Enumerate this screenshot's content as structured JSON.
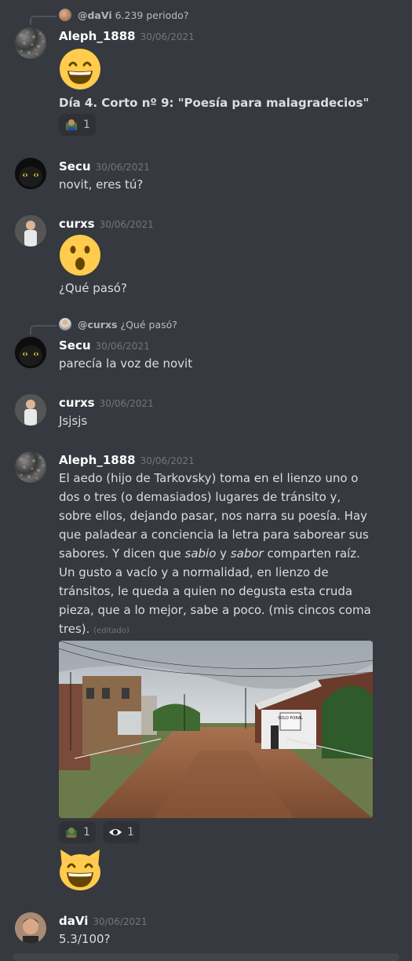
{
  "messages": [
    {
      "reply_user": "@daVi",
      "reply_text": "6.239 periodo?",
      "user": "Aleph_1888",
      "time": "30/06/2021",
      "emoji": "grinning-face",
      "bold_text": "Día 4. Corto nº 9: \"Poesía para malagradecios\"",
      "reactions": [
        {
          "icon": "custom-emoji-1",
          "count": "1"
        }
      ]
    },
    {
      "user": "Secu",
      "time": "30/06/2021",
      "text": "novit, eres tú?"
    },
    {
      "user": "curxs",
      "time": "30/06/2021",
      "emoji": "hushed-face",
      "text": "¿Qué pasó?"
    },
    {
      "reply_user": "@curxs",
      "reply_text": "¿Qué pasó?",
      "user": "Secu",
      "time": "30/06/2021",
      "text": "parecía la voz de novit"
    },
    {
      "user": "curxs",
      "time": "30/06/2021",
      "text": "Jsjsjs"
    },
    {
      "user": "Aleph_1888",
      "time": "30/06/2021",
      "lines": [
        "El aedo (hijo de Tarkovsky) toma en el lienzo uno o",
        "dos o tres (o demasiados) lugares de tránsito y,",
        "sobre ellos, dejando pasar, nos narra su poesía. Hay",
        "que paladear a conciencia la letra para saborear sus"
      ],
      "line5_a": "sabores. Y dicen que ",
      "line5_i1": "sabio",
      "line5_b": " y ",
      "line5_i2": "sabor",
      "line5_c": " comparten raíz.",
      "lines_after": [
        "Un gusto a vacío y a normalidad, en lienzo de",
        "tránsitos, le queda a quien no degusta esta cruda",
        "pieza, que a lo mejor, sabe a poco.  (mis cincos coma"
      ],
      "last_line": "tres).",
      "edited": "(editado)",
      "sign_text": "SOLO PORAL",
      "reactions": [
        {
          "icon": "custom-emoji-2",
          "count": "1"
        },
        {
          "icon": "eye-emoji",
          "count": "1"
        }
      ],
      "emoji_after": "grinning-cat"
    },
    {
      "user": "daVi",
      "time": "30/06/2021",
      "text": "5.3/100?"
    }
  ]
}
